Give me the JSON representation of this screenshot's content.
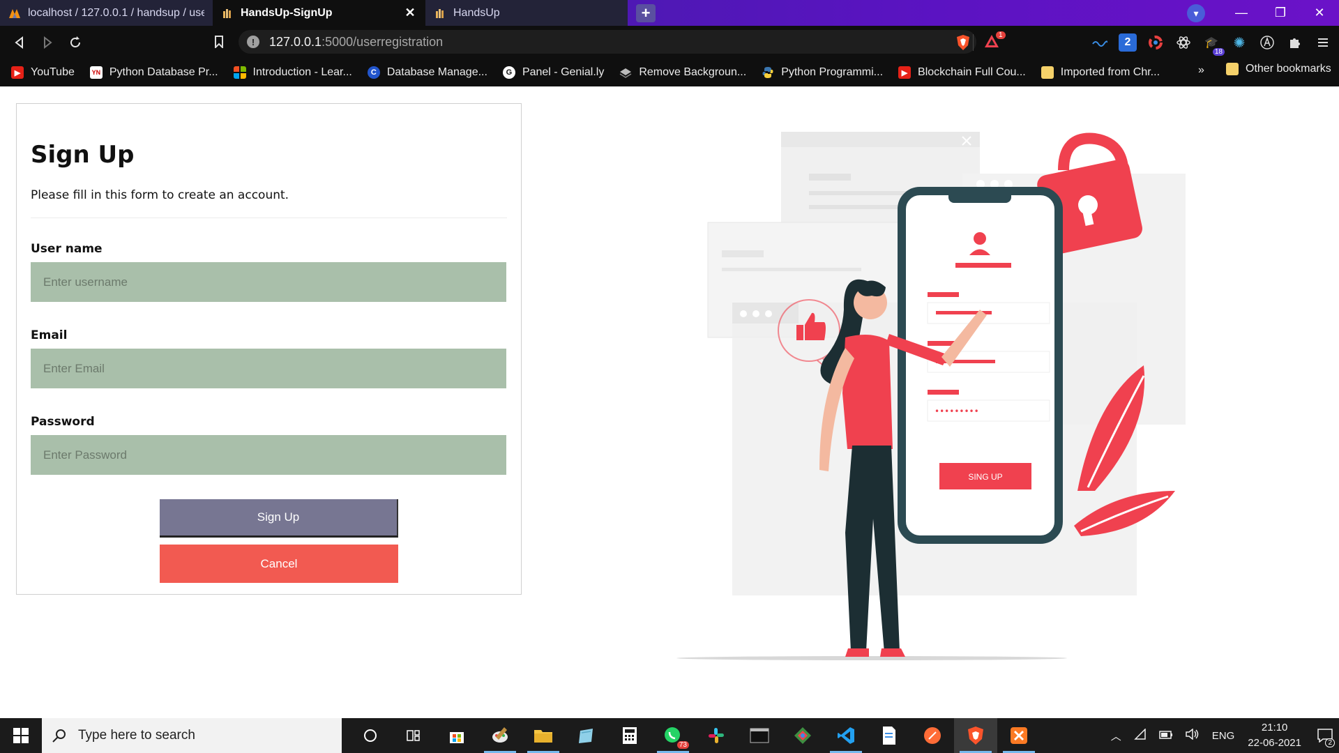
{
  "browser": {
    "tabs": [
      {
        "label": "localhost / 127.0.0.1 / handsup / users",
        "active": false
      },
      {
        "label": "HandsUp-SignUp",
        "active": true
      },
      {
        "label": "HandsUp",
        "active": false
      }
    ],
    "url_host": "127.0.0.1",
    "url_path": ":5000/userregistration",
    "notification_badge": "1",
    "extension_badge": "18",
    "extension_number": "2",
    "bookmarks": [
      {
        "label": "YouTube",
        "icon": "youtube-icon"
      },
      {
        "label": "Python Database Pr...",
        "icon": "yn-icon"
      },
      {
        "label": "Introduction - Lear...",
        "icon": "microsoft-icon"
      },
      {
        "label": "Database Manage...",
        "icon": "c-icon"
      },
      {
        "label": "Panel - Genial.ly",
        "icon": "genially-icon"
      },
      {
        "label": "Remove Backgroun...",
        "icon": "layers-icon"
      },
      {
        "label": "Python Programmi...",
        "icon": "python-icon"
      },
      {
        "label": "Blockchain Full Cou...",
        "icon": "youtube-icon"
      },
      {
        "label": "Imported from Chr...",
        "icon": "folder-icon"
      }
    ],
    "bookmarks_more": "»",
    "other_bookmarks": "Other bookmarks"
  },
  "form": {
    "title": "Sign Up",
    "subtitle": "Please fill in this form to create an account.",
    "username_label": "User name",
    "username_placeholder": "Enter username",
    "email_label": "Email",
    "email_placeholder": "Enter Email",
    "password_label": "Password",
    "password_placeholder": "Enter Password",
    "signup_button": "Sign Up",
    "cancel_button": "Cancel"
  },
  "illustration": {
    "phone_button": "SING UP",
    "password_dots": "•••••••••"
  },
  "colors": {
    "input_bg": "#a9bfaa",
    "signup_bg": "#777692",
    "cancel_bg": "#f25a51",
    "accent_red": "#f0414f"
  },
  "taskbar": {
    "search_placeholder": "Type here to search",
    "whatsapp_badge": "73",
    "language": "ENG",
    "time": "21:10",
    "date": "22-06-2021",
    "notifications_count": "2"
  }
}
